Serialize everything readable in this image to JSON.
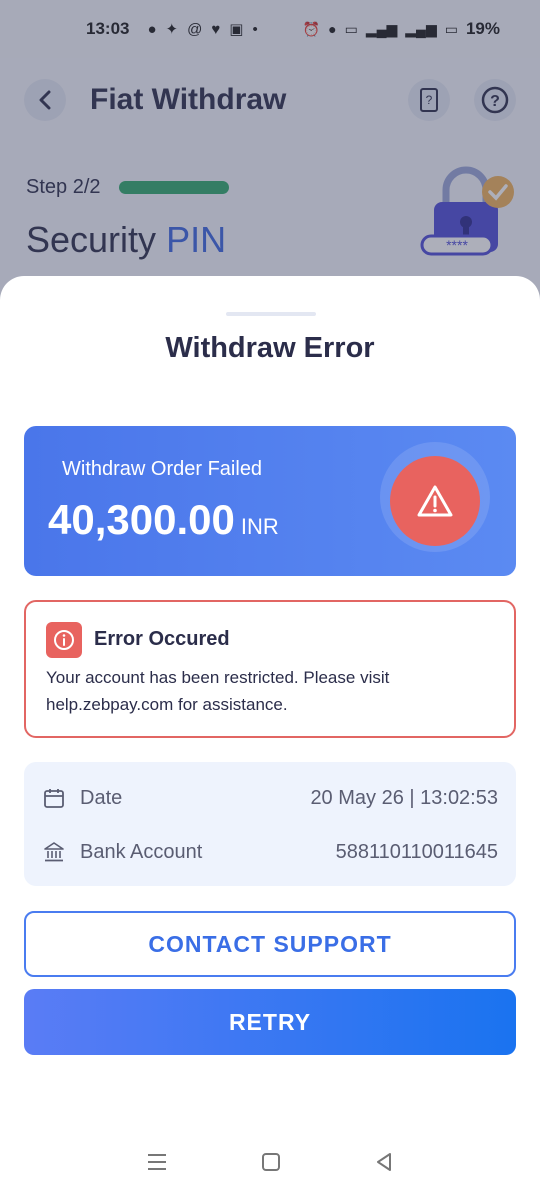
{
  "status_bar": {
    "time": "13:03",
    "battery": "19%",
    "left_icons": [
      "chat-icon",
      "bolt-icon",
      "threads-icon",
      "heart-icon",
      "calendar-icon",
      "dot-icon"
    ],
    "right_icons": [
      "alarm-icon",
      "location-icon",
      "volte-icon",
      "signal-icon",
      "4g-icon",
      "battery-icon"
    ]
  },
  "app_bar": {
    "title": "Fiat Withdraw"
  },
  "step": {
    "label": "Step 2/2",
    "heading_part1": "Security",
    "heading_part2": "PIN",
    "pin_mask": "****"
  },
  "sheet": {
    "title": "Withdraw Error",
    "fail_card": {
      "label": "Withdraw Order Failed",
      "amount": "40,300.00",
      "currency": "INR"
    },
    "error": {
      "title": "Error Occured",
      "message": "Your account has been restricted. Please visit help.zebpay.com for assistance."
    },
    "details": [
      {
        "label": "Date",
        "value": "20 May 26 | 13:02:53",
        "icon": "calendar-icon"
      },
      {
        "label": "Bank Account",
        "value": "588110110011645",
        "icon": "bank-icon"
      }
    ],
    "contact_label": "CONTACT SUPPORT",
    "retry_label": "RETRY"
  },
  "colors": {
    "primary": "#3a6ee6",
    "error": "#e8635f",
    "success": "#2faa6c"
  }
}
